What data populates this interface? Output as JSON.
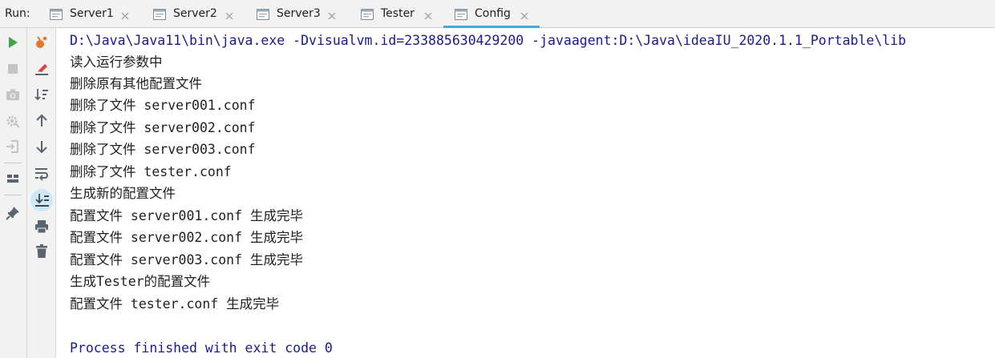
{
  "run_label": "Run:",
  "tabs": [
    {
      "label": "Server1",
      "active": false
    },
    {
      "label": "Server2",
      "active": false
    },
    {
      "label": "Server3",
      "active": false
    },
    {
      "label": "Tester",
      "active": false
    },
    {
      "label": "Config",
      "active": true
    }
  ],
  "toolbar": {
    "primary": [
      "run-icon",
      "stop-icon",
      "camera-icon",
      "debug-gear-icon",
      "exit-login-icon",
      "layout-icon",
      "pin-icon"
    ],
    "secondary": [
      "profiler-icon",
      "clear-line-icon",
      "sort-icon",
      "up-arrow-icon",
      "down-arrow-icon",
      "soft-wrap-icon",
      "scroll-to-end-icon",
      "print-icon",
      "trash-icon"
    ]
  },
  "console": {
    "command": "D:\\Java\\Java11\\bin\\java.exe -Dvisualvm.id=233885630429200 -javaagent:D:\\Java\\ideaIU_2020.1.1_Portable\\lib",
    "lines": [
      "读入运行参数中",
      "删除原有其他配置文件",
      "删除了文件 server001.conf",
      "删除了文件 server002.conf",
      "删除了文件 server003.conf",
      "删除了文件 tester.conf",
      "生成新的配置文件",
      "配置文件 server001.conf 生成完毕",
      "配置文件 server002.conf 生成完毕",
      "配置文件 server003.conf 生成完毕",
      "生成Tester的配置文件",
      "配置文件 tester.conf 生成完毕",
      ""
    ],
    "exit_message": "Process finished with exit code 0"
  },
  "colors": {
    "command_text": "#1a1a8c",
    "run_green": "#3fa845",
    "accent_tab": "#4aa8d8",
    "toolbar_bg": "#f2f2f2"
  }
}
